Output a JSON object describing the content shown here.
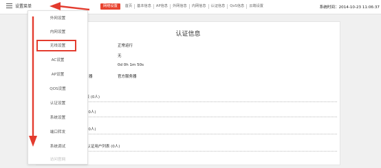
{
  "header": {
    "menu_label": "设置菜单",
    "nav": [
      "网络设置",
      "首页",
      "基本信息",
      "AP信息",
      "外网信息",
      "内网信息",
      "认证信息",
      "QoS信息",
      "云端设置"
    ],
    "active_nav_index": 0,
    "system_time": "系统时间：2014-10-23 11:06:37"
  },
  "dropdown": {
    "items": [
      "外网设置",
      "内网设置",
      "无线设置",
      "AC设置",
      "AP设置",
      "QOS设置",
      "认证设置",
      "系统设置",
      "端口转发",
      "系统调试",
      "访问官网"
    ],
    "highlighted_index": 2,
    "disabled_index": 10
  },
  "main": {
    "title": "认证信息",
    "info_rows": [
      {
        "label": "",
        "value": "正常运行"
      },
      {
        "label": "",
        "value": "无"
      },
      {
        "label": "",
        "value": "0d 0h 1m 50s"
      },
      {
        "label": "器",
        "value": "官方服务器"
      }
    ],
    "sections": [
      "通过列表 (0人)",
      "证列表 (0人)",
      "单列表 (0人)",
      "免/黑单认证用户列表 (0人)"
    ]
  },
  "colors": {
    "accent": "#e8432f",
    "annotation": "#e33b2e"
  }
}
